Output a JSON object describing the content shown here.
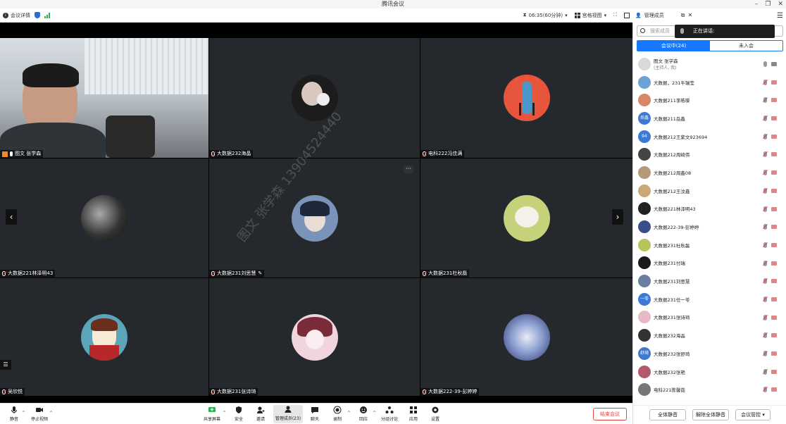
{
  "window": {
    "title": "腾讯会议"
  },
  "topbar": {
    "meeting_details": "会议详情",
    "timer": "06:35(60分钟)",
    "view_mode": "宫格视图"
  },
  "panel_header": {
    "title": "管理成员"
  },
  "panel": {
    "search_placeholder": "搜索成员",
    "speaking_label": "正在讲话:",
    "tabs": [
      "会议中(24)",
      "未入会"
    ],
    "participants": [
      {
        "name": "图文 张学森",
        "sub": "(主持人, 我)",
        "color": "#d9d9d9",
        "mic": "on",
        "cam": "on"
      },
      {
        "name": "大数据，231牛瑞莹",
        "color": "#6aa3d8",
        "mic": "off",
        "cam": "off"
      },
      {
        "name": "大数据211李皓璨",
        "color": "#d9856a",
        "mic": "off",
        "cam": "off"
      },
      {
        "name": "大数据211岳鑫",
        "initials": "岳鑫",
        "color": "#3d7ad6",
        "mic": "off",
        "cam": "off"
      },
      {
        "name": "大数据212王紫文923694",
        "initials": "94",
        "color": "#3d7ad6",
        "mic": "off",
        "cam": "off"
      },
      {
        "name": "大数据212周崎伟",
        "color": "#444",
        "mic": "off",
        "cam": "off"
      },
      {
        "name": "大数据212周鑫08",
        "color": "#b59a7a",
        "mic": "off",
        "cam": "off"
      },
      {
        "name": "大数据212王汶鑫",
        "color": "#caa878",
        "mic": "off",
        "cam": "off"
      },
      {
        "name": "大数据221林泽明43",
        "color": "#222",
        "mic": "off",
        "cam": "off"
      },
      {
        "name": "大数据222-39-彭婷婷",
        "color": "#3b4e8a",
        "mic": "off",
        "cam": "off"
      },
      {
        "name": "大数据231杜秋磊",
        "color": "#b8c45a",
        "mic": "off",
        "cam": "off"
      },
      {
        "name": "大数据231付瑞",
        "color": "#1a1a1a",
        "mic": "off",
        "cam": "off"
      },
      {
        "name": "大数据231刘思慧",
        "color": "#6c7fa3",
        "mic": "off",
        "cam": "off"
      },
      {
        "name": "大数据231任一苓",
        "initials": "一苓",
        "color": "#3d7ad6",
        "mic": "off",
        "cam": "off"
      },
      {
        "name": "大数据231张诗琦",
        "color": "#e6b9c4",
        "mic": "off",
        "cam": "off"
      },
      {
        "name": "大数据232海晶",
        "color": "#333",
        "mic": "off",
        "cam": "off"
      },
      {
        "name": "大数据232张舒琦",
        "initials": "舒琦",
        "color": "#3d7ad6",
        "mic": "off",
        "cam": "off"
      },
      {
        "name": "大数据232张艳",
        "color": "#b35a6a",
        "mic": "off",
        "cam": "off"
      },
      {
        "name": "电科221陈馨茹",
        "color": "#777",
        "mic": "off",
        "cam": "off"
      }
    ],
    "footer": {
      "mute_all": "全体静音",
      "unmute_all": "解除全体静音",
      "manage": "会议管控"
    }
  },
  "tiles": [
    {
      "name": "图文 张学森",
      "type": "camera"
    },
    {
      "name": "大数据232海晶",
      "avatar_color": "#1c1c1c"
    },
    {
      "name": "电科222冯佳满",
      "avatar_color": "#e8553d"
    },
    {
      "name": "大数据221林泽明43",
      "avatar_color": "#444"
    },
    {
      "name": "大数据231刘思慧",
      "avatar_color": "#7a93b8"
    },
    {
      "name": "大数据231杜秋磊",
      "avatar_color": "#c5d27a"
    },
    {
      "name": "吴欣悦",
      "avatar_color": "#5aa5b8"
    },
    {
      "name": "大数据231张诗琦",
      "avatar_color": "#f0d6dc"
    },
    {
      "name": "大数据222-39-彭婷婷",
      "avatar_color": "#6b86c8"
    }
  ],
  "watermark": "图文 张学森 13904524440",
  "bottombar": {
    "mute": "静音",
    "stop_video": "停止视频",
    "share": "共享屏幕",
    "security": "安全",
    "invite": "邀请",
    "members": "管理成员(23)",
    "chat": "聊天",
    "record": "录制",
    "react": "回应",
    "breakout": "分组讨论",
    "apps": "应用",
    "settings": "设置",
    "end": "结束会议"
  }
}
